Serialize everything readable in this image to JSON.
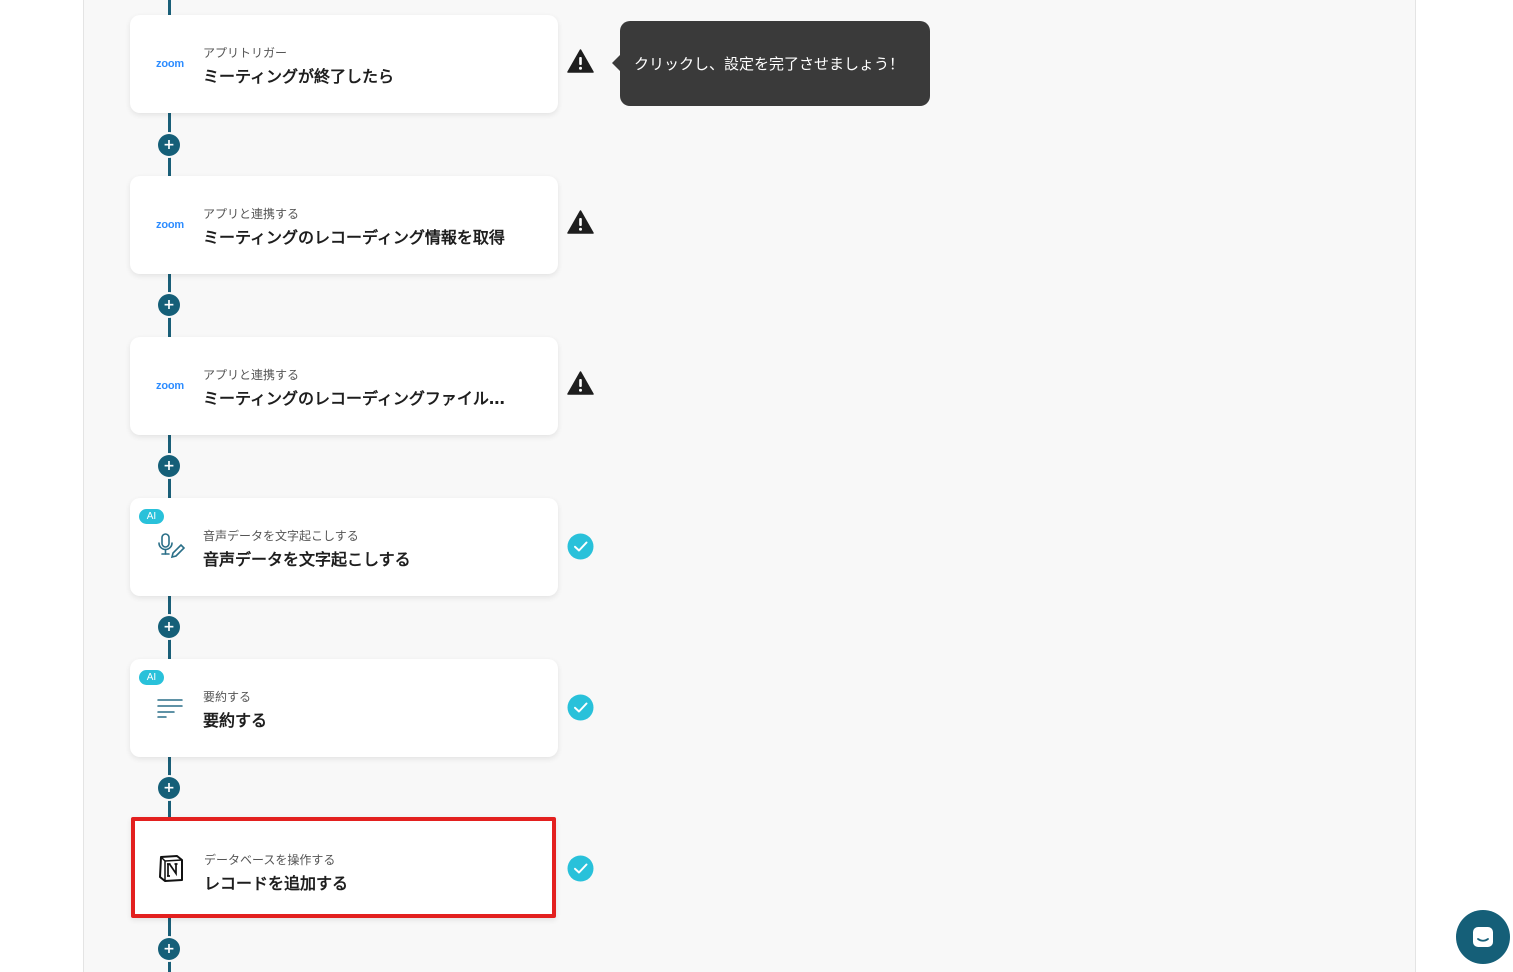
{
  "tooltip": {
    "text": "クリックし、設定を完了させましょう！"
  },
  "steps": [
    {
      "app": "zoom",
      "icon": "zoom-logo",
      "subtitle": "アプリトリガー",
      "title": "ミーティングが終了したら",
      "status": "warning"
    },
    {
      "app": "zoom",
      "icon": "zoom-logo",
      "subtitle": "アプリと連携する",
      "title": "ミーティングのレコーディング情報を取得",
      "status": "warning"
    },
    {
      "app": "zoom",
      "icon": "zoom-logo",
      "subtitle": "アプリと連携する",
      "title": "ミーティングのレコーディングファイル…",
      "status": "warning"
    },
    {
      "app": "ai",
      "badge": "AI",
      "icon": "microphone-pen-icon",
      "subtitle": "音声データを文字起こしする",
      "title": "音声データを文字起こしする",
      "status": "done"
    },
    {
      "app": "ai",
      "badge": "AI",
      "icon": "summary-lines-icon",
      "subtitle": "要約する",
      "title": "要約する",
      "status": "done"
    },
    {
      "app": "notion",
      "icon": "notion-logo",
      "subtitle": "データベースを操作する",
      "title": "レコードを追加する",
      "status": "done",
      "highlighted": true
    }
  ],
  "add_button": {
    "glyph": "+"
  },
  "colors": {
    "flow": "#155f78",
    "done": "#29c1da",
    "warning": "#1e1e1e",
    "highlight": "#e3201f",
    "zoom": "#2d8cff"
  }
}
